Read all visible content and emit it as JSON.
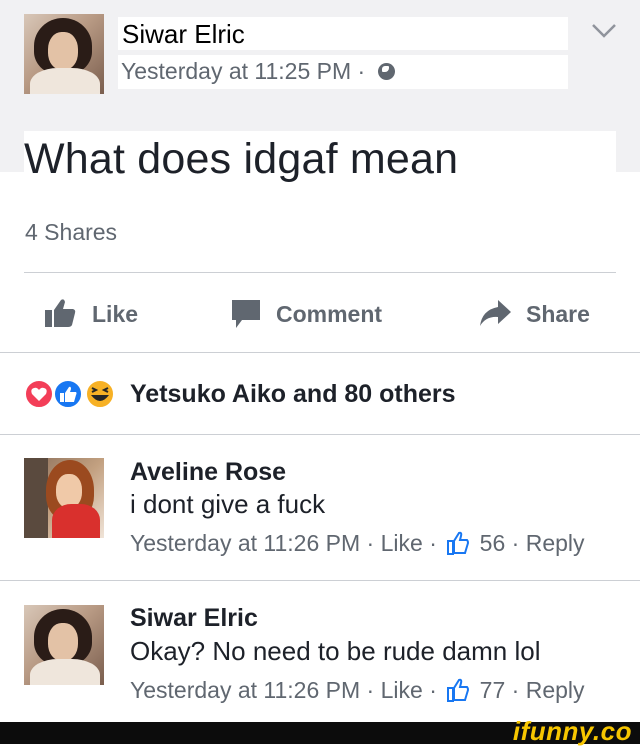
{
  "post": {
    "author": "Siwar Elric",
    "timestamp": "Yesterday at 11:25 PM",
    "separator": "·",
    "audience_icon": "globe-icon",
    "text": "What does idgaf mean",
    "shares": "4 Shares"
  },
  "actions": {
    "like": "Like",
    "comment": "Comment",
    "share": "Share"
  },
  "reactions": {
    "icons": [
      "love-reaction-icon",
      "like-reaction-icon",
      "haha-reaction-icon"
    ],
    "summary": "Yetsuko Aiko and 80 others"
  },
  "comments": [
    {
      "author": "Aveline Rose",
      "text": "i dont give a fuck",
      "timestamp": "Yesterday at 11:26 PM",
      "like_label": "Like",
      "like_count": "56",
      "reply_label": "Reply"
    },
    {
      "author": "Siwar Elric",
      "text": "Okay? No need to be rude damn lol",
      "timestamp": "Yesterday at 11:26 PM",
      "like_label": "Like",
      "like_count": "77",
      "reply_label": "Reply"
    }
  ],
  "watermark": "ifunny.co",
  "colors": {
    "text": "#1d2129",
    "secondary": "#606770",
    "divider": "#cccfd4",
    "like_blue": "#1877f2",
    "love_red": "#f33e58",
    "haha_yellow": "#f7b125",
    "watermark_yellow": "#f7c600"
  }
}
